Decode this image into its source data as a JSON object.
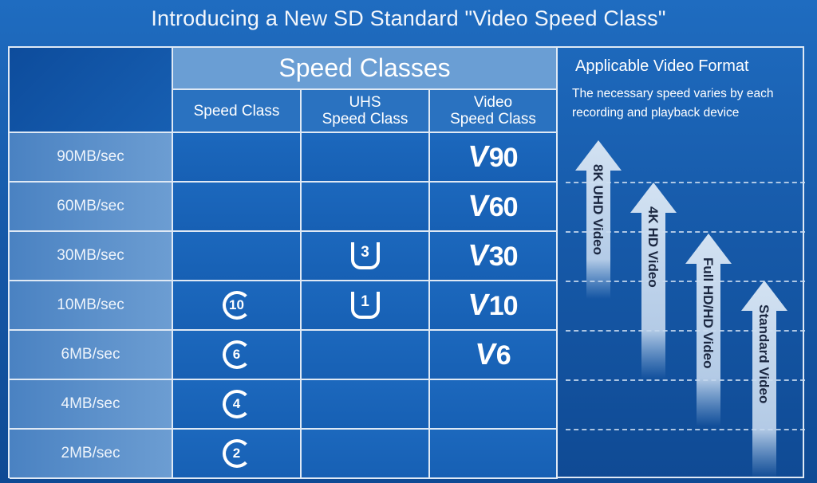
{
  "title": "Introducing a New SD Standard \"Video Speed Class\"",
  "header": {
    "speed_classes": "Speed Classes",
    "speed_class": "Speed Class",
    "uhs_line1": "UHS",
    "uhs_line2": "Speed Class",
    "video_line1": "Video",
    "video_line2": "Speed Class"
  },
  "format": {
    "title": "Applicable Video Format",
    "description": "The necessary speed varies by each recording and playback device",
    "arrows": [
      "8K UHD Video",
      "4K HD Video",
      "Full HD/HD Video",
      "Standard Video"
    ]
  },
  "rows": [
    {
      "speed": "90MB/sec",
      "speed_class": "",
      "uhs": "",
      "video": "90"
    },
    {
      "speed": "60MB/sec",
      "speed_class": "",
      "uhs": "",
      "video": "60"
    },
    {
      "speed": "30MB/sec",
      "speed_class": "",
      "uhs": "3",
      "video": "30"
    },
    {
      "speed": "10MB/sec",
      "speed_class": "10",
      "uhs": "1",
      "video": "10"
    },
    {
      "speed": "6MB/sec",
      "speed_class": "6",
      "uhs": "",
      "video": "6"
    },
    {
      "speed": "4MB/sec",
      "speed_class": "4",
      "uhs": "",
      "video": ""
    },
    {
      "speed": "2MB/sec",
      "speed_class": "2",
      "uhs": "",
      "video": ""
    }
  ],
  "video_prefix": "V",
  "colors": {
    "background": "#1659a8",
    "label_column": "#5b8fc8",
    "header": "#6a9ed4",
    "arrow": "#c8daee",
    "arrow_text": "#1b2740"
  }
}
